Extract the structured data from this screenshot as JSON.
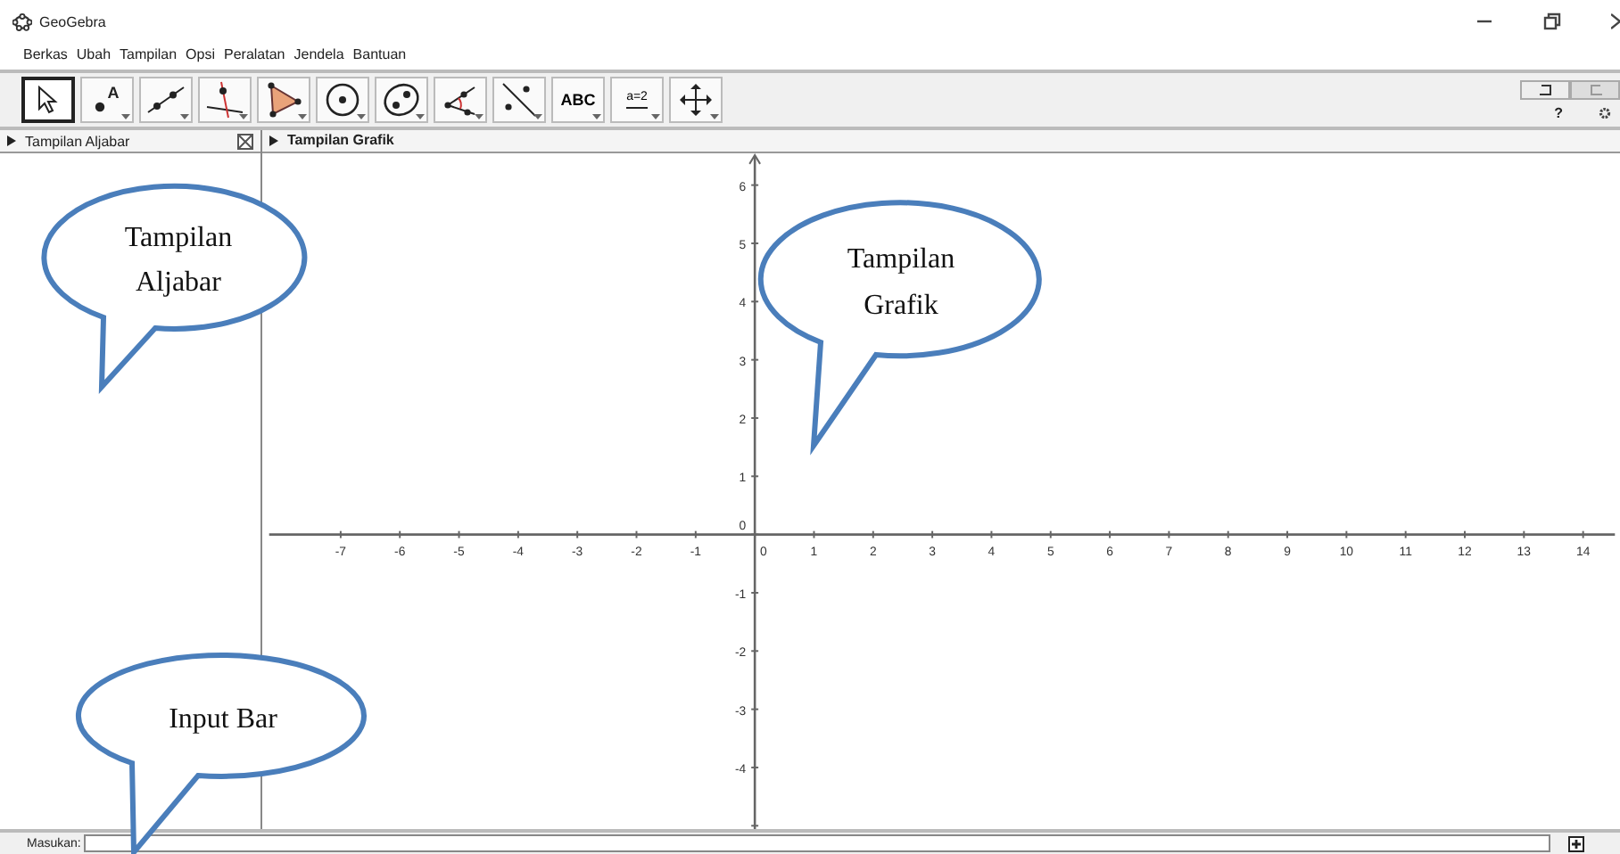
{
  "window": {
    "title": "GeoGebra"
  },
  "menu": [
    "Berkas",
    "Ubah",
    "Tampilan",
    "Opsi",
    "Peralatan",
    "Jendela",
    "Bantuan"
  ],
  "toolbar": {
    "tools": [
      {
        "kind": "move",
        "selected": true
      },
      {
        "kind": "point",
        "label": "A",
        "selected": false
      },
      {
        "kind": "line",
        "selected": false
      },
      {
        "kind": "perpendicular",
        "selected": false
      },
      {
        "kind": "polygon",
        "selected": false
      },
      {
        "kind": "circle",
        "selected": false
      },
      {
        "kind": "conic",
        "selected": false
      },
      {
        "kind": "angle",
        "selected": false
      },
      {
        "kind": "reflect",
        "selected": false
      },
      {
        "kind": "text",
        "label": "ABC",
        "selected": false
      },
      {
        "kind": "slider",
        "label": "a=2",
        "selected": false
      },
      {
        "kind": "move-view",
        "selected": false
      }
    ],
    "help": "?"
  },
  "algebra_view": {
    "title": "Tampilan Aljabar"
  },
  "graphics_view": {
    "title": "Tampilan Grafik",
    "x_axis": {
      "negative_labels": [
        "-7",
        "-6",
        "-5",
        "-4",
        "-3",
        "-2",
        "-1"
      ],
      "origin_label": "0",
      "positive_labels": [
        "1",
        "2",
        "3",
        "4",
        "5",
        "6",
        "7",
        "8",
        "9",
        "10",
        "11",
        "12",
        "13",
        "14"
      ]
    },
    "y_axis": {
      "positive_labels": [
        "6",
        "5",
        "4",
        "3",
        "2",
        "1"
      ],
      "origin_label": "0",
      "negative_labels": [
        "-1",
        "-2",
        "-3",
        "-4"
      ]
    }
  },
  "input_bar": {
    "label": "Masukan:"
  },
  "callouts": [
    {
      "lines": [
        "Tampilan",
        "Aljabar"
      ]
    },
    {
      "lines": [
        "Tampilan",
        "Grafik"
      ]
    },
    {
      "lines": [
        "Input Bar"
      ]
    }
  ]
}
